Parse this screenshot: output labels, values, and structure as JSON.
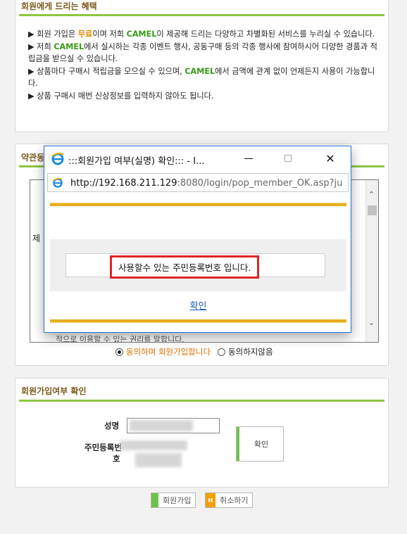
{
  "benefits": {
    "title": "회원에게 드리는 혜택",
    "items": [
      {
        "bullet": "▶ ",
        "p1": "회원 가입은 ",
        "h1": "무료",
        "p2": "이며 저희 ",
        "h2": "CAMEL",
        "p3": "이 제공해 드리는 다양하고 차별화된 서비스를 누리실 수 있습니다."
      },
      {
        "bullet": "▶ ",
        "p1": "저희 ",
        "h2": "CAMEL",
        "p3": "에서 실시하는 각종 이벤트 행사, 공동구매 등의 각종 행사에 참여하시어 다양한 경품과 적립금을 받으실 수 있습니다."
      },
      {
        "bullet": "▶ ",
        "p1": "상품마다 구매시 적립금을 모으실 수 있으며, ",
        "h2": "CAMEL",
        "p3": "에서 금액에 관계 없이 언제든지 사용이 가능합니다."
      },
      {
        "bullet": "▶ ",
        "p1": "상품 구매시 매번 신상정보를 입력하지 않아도 됩니다."
      }
    ]
  },
  "terms": {
    "title": "약관동",
    "visible_char": "제",
    "tail_text": "적으로 이용할 수 있는 권리를 말합니다.",
    "agree_label": "동의하며 회원가입합니다",
    "disagree_label": "동의하지않음"
  },
  "confirm": {
    "title": "회원가입여부 확인",
    "name_label": "성명",
    "rrn_label_line1": "주민등록번",
    "rrn_label_line2": "호",
    "confirm_button": "확인"
  },
  "bottom": {
    "join_button": "회원가입",
    "cancel_button": "취소하기",
    "cancel_badge": "H"
  },
  "popup": {
    "title": ":::회원가입 여부(실명) 확인::: - I...",
    "url_host": "http://192.168.211.129",
    "url_rest": ":8080/login/pop_member_OK.asp?ju",
    "message": "사용할수 있는 주민등록번호 입니다.",
    "ok_link": "확인",
    "close_glyph": "✕"
  },
  "colors": {
    "accent_green": "#8cc63f",
    "popup_gold": "#e7ad1d",
    "highlight_red": "#e02424",
    "window_border": "#2a6fd6"
  }
}
